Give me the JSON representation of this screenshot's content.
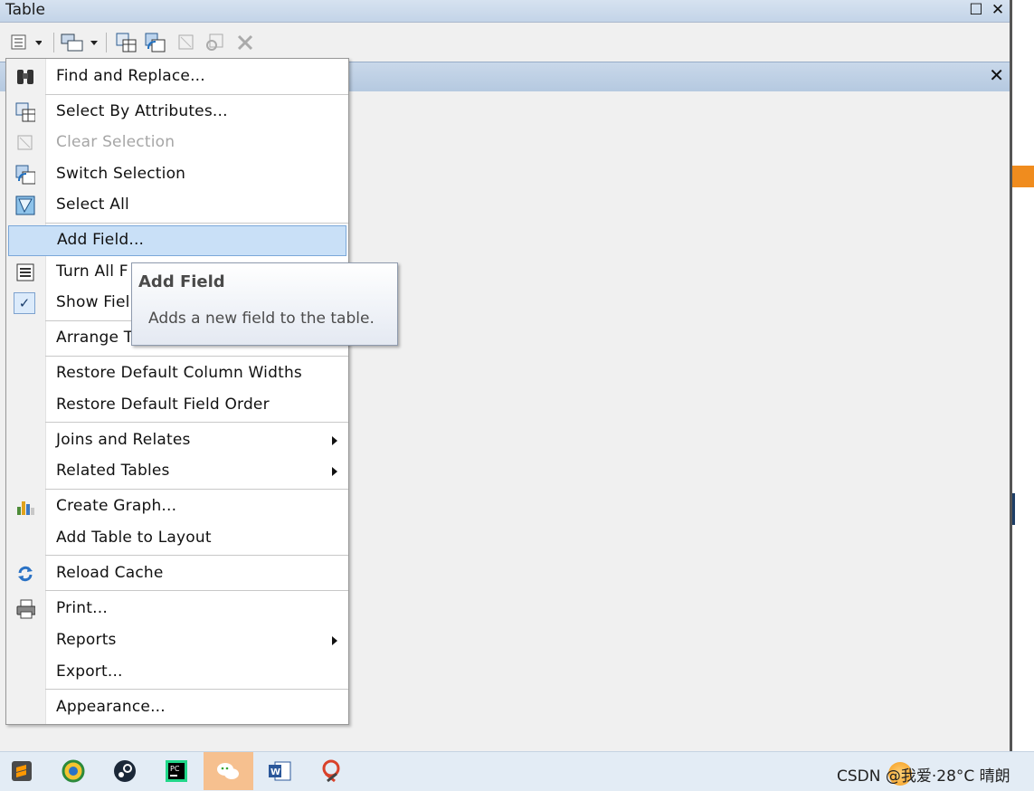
{
  "window": {
    "title": "Table"
  },
  "menu": {
    "items": [
      {
        "label": "Find and Replace...",
        "icon": "binoculars-icon",
        "disabled": false
      },
      {
        "label": "Select By Attributes...",
        "icon": "select-by-attributes-icon",
        "disabled": false
      },
      {
        "label": "Clear Selection",
        "icon": "clear-selection-icon",
        "disabled": true
      },
      {
        "label": "Switch Selection",
        "icon": "switch-selection-icon",
        "disabled": false
      },
      {
        "label": "Select All",
        "icon": "select-all-icon",
        "disabled": false
      },
      {
        "label": "Add Field...",
        "icon": "",
        "disabled": false,
        "highlighted": true
      },
      {
        "label": "Turn All F",
        "icon": "field-list-icon",
        "disabled": false
      },
      {
        "label": "Show Fiel",
        "icon": "checkmark-icon",
        "disabled": false
      },
      {
        "label": "Arrange T",
        "icon": "",
        "disabled": false
      },
      {
        "label": "Restore Default Column Widths",
        "icon": "",
        "disabled": false
      },
      {
        "label": "Restore Default Field Order",
        "icon": "",
        "disabled": false
      },
      {
        "label": "Joins and Relates",
        "icon": "",
        "disabled": false,
        "submenu": true
      },
      {
        "label": "Related Tables",
        "icon": "",
        "disabled": false,
        "submenu": true
      },
      {
        "label": "Create Graph...",
        "icon": "bar-graph-icon",
        "disabled": false
      },
      {
        "label": "Add Table to Layout",
        "icon": "",
        "disabled": false
      },
      {
        "label": "Reload Cache",
        "icon": "reload-icon",
        "disabled": false
      },
      {
        "label": "Print...",
        "icon": "printer-icon",
        "disabled": false
      },
      {
        "label": "Reports",
        "icon": "",
        "disabled": false,
        "submenu": true
      },
      {
        "label": "Export...",
        "icon": "",
        "disabled": false
      },
      {
        "label": "Appearance...",
        "icon": "",
        "disabled": false
      }
    ]
  },
  "tooltip": {
    "title": "Add Field",
    "description": "Adds a new field to the table."
  },
  "taskbar": {
    "apps": [
      "sublime-text-icon",
      "browser-icon",
      "steam-icon",
      "pycharm-icon",
      "wechat-icon",
      "word-icon",
      "snipping-tool-icon"
    ],
    "tray_text": "CSDN @我爱·28°C  晴朗"
  },
  "colors": {
    "menu_highlight": "#c9e0f7",
    "tooltip_border": "#8e9aad",
    "titlebar": "#c3d4e8"
  }
}
